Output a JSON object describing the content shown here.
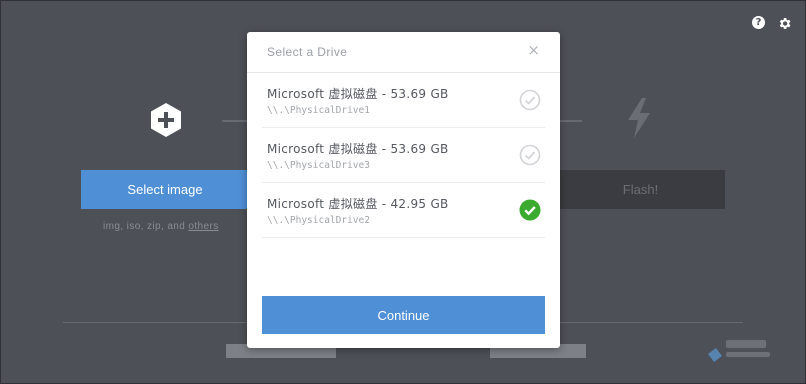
{
  "header": {
    "help_icon": "help-icon",
    "settings_icon": "gear-icon",
    "help_glyph": "?"
  },
  "steps": {
    "select_image_label": "Select image",
    "formats_text": "img, iso, zip, and ",
    "formats_link": "others",
    "flash_label": "Flash!"
  },
  "dialog": {
    "title": "Select a Drive",
    "close_glyph": "×",
    "drives": [
      {
        "name": "Microsoft 虚拟磁盘 - 53.69 GB",
        "path": "\\\\.\\PhysicalDrive1",
        "selected": false
      },
      {
        "name": "Microsoft 虚拟磁盘 - 53.69 GB",
        "path": "\\\\.\\PhysicalDrive3",
        "selected": false
      },
      {
        "name": "Microsoft 虚拟磁盘 - 42.95 GB",
        "path": "\\\\.\\PhysicalDrive2",
        "selected": true
      }
    ],
    "continue_label": "Continue"
  },
  "colors": {
    "accent": "#4f8fd6",
    "selected_check": "#3bab30",
    "background": "#4d5057"
  }
}
